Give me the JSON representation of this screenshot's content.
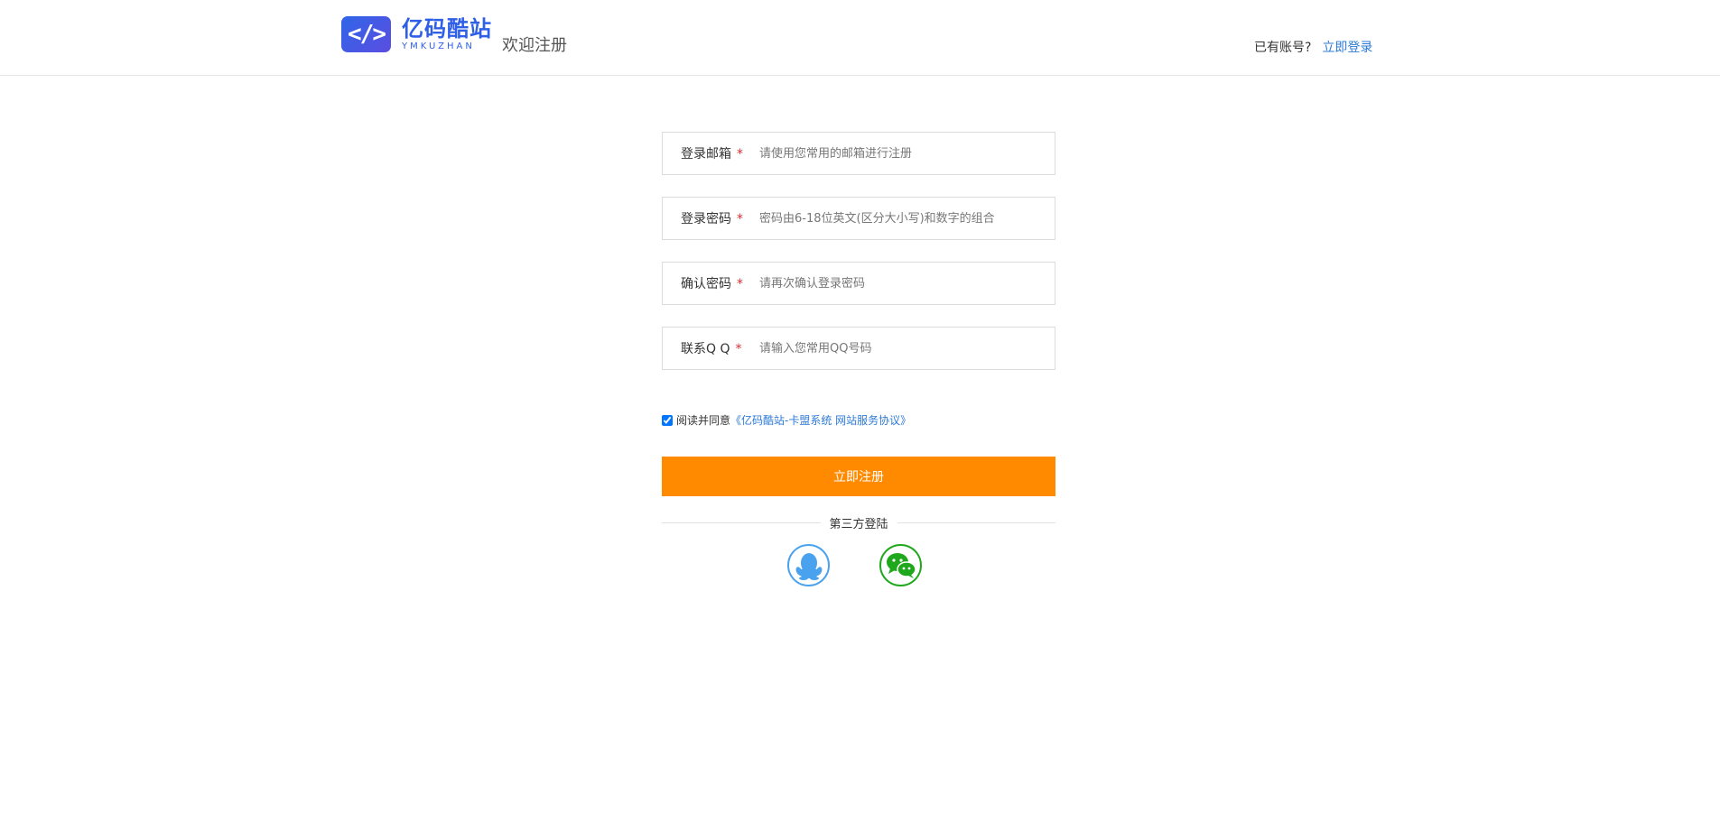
{
  "header": {
    "logo_badge": "</>",
    "logo_cn": "亿码酷站",
    "logo_en": "YMKUZHAN",
    "welcome": "欢迎注册",
    "account_prompt": "已有账号?",
    "login_link": "立即登录"
  },
  "form": {
    "fields": [
      {
        "label": "登录邮箱",
        "required_mark": "*",
        "placeholder": "请使用您常用的邮箱进行注册"
      },
      {
        "label": "登录密码",
        "required_mark": "*",
        "placeholder": "密码由6-18位英文(区分大小写)和数字的组合"
      },
      {
        "label": "确认密码",
        "required_mark": "*",
        "placeholder": "请再次确认登录密码"
      },
      {
        "label": "联系Q Q",
        "required_mark": "*",
        "placeholder": "请输入您常用QQ号码"
      }
    ],
    "agree_text": "阅读并同意",
    "agreement_link": "《亿码酷站-卡盟系统 网站服务协议》",
    "agree_checked": true,
    "submit_label": "立即注册",
    "third_party_label": "第三方登陆"
  },
  "icons": {
    "qq": "qq-penguin-icon",
    "wechat": "wechat-icon"
  },
  "colors": {
    "accent_orange": "#ff8a00",
    "link_blue": "#2d7ad6",
    "brand_blue": "#2f5fe6",
    "qq_blue": "#4aa2ee",
    "wechat_green": "#20a81c"
  }
}
